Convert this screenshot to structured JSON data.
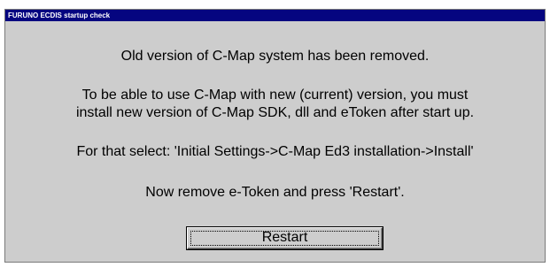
{
  "window": {
    "title": "FURUNO ECDIS startup check"
  },
  "messages": {
    "line1": "Old version of C-Map system has been removed.",
    "line2": "To be able to use C-Map with new (current) version, you must",
    "line3": "install new version of C-Map SDK, dll and eToken after start up.",
    "line4": "For that select: 'Initial Settings->C-Map Ed3 installation->Install'",
    "line5": "Now remove e-Token and press 'Restart'."
  },
  "buttons": {
    "restart_label": "Restart"
  },
  "colors": {
    "titlebar": "#050580",
    "dialog_background": "#cdcdcd"
  }
}
